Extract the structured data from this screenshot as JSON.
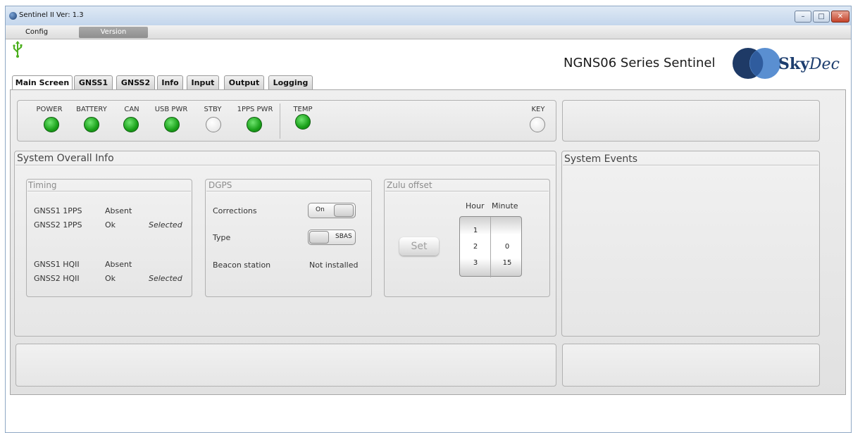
{
  "window": {
    "title": "Sentinel II Ver: 1.3"
  },
  "window_controls": {
    "minimize": "–",
    "maximize": "□",
    "close": "✕"
  },
  "menu": {
    "items": [
      "Config",
      "Version"
    ],
    "active_index": 1
  },
  "header": {
    "series_title": "NGNS06 Series Sentinel",
    "logo_text_a": "Sky",
    "logo_text_b": "Dec"
  },
  "tabs": [
    "Main Screen",
    "GNSS1",
    "GNSS2",
    "Info",
    "Input",
    "Output",
    "Logging"
  ],
  "indicators": [
    {
      "label": "POWER",
      "state": "on"
    },
    {
      "label": "BATTERY",
      "state": "on"
    },
    {
      "label": "CAN",
      "state": "on"
    },
    {
      "label": "USB PWR",
      "state": "on"
    },
    {
      "label": "STBY",
      "state": "off"
    },
    {
      "label": "1PPS PWR",
      "state": "on"
    },
    {
      "label": "TEMP",
      "state": "on"
    },
    {
      "label": "KEY",
      "state": "off"
    }
  ],
  "system_info": {
    "title": "System Overall Info",
    "timing": {
      "title": "Timing",
      "rows": [
        {
          "name": "GNSS1 1PPS",
          "status": "Absent",
          "note": ""
        },
        {
          "name": "GNSS2 1PPS",
          "status": "Ok",
          "note": "Selected"
        },
        {
          "name": "GNSS1 HQII",
          "status": "Absent",
          "note": ""
        },
        {
          "name": "GNSS2 HQII",
          "status": "Ok",
          "note": "Selected"
        }
      ]
    },
    "dgps": {
      "title": "DGPS",
      "corrections_label": "Corrections",
      "corrections_value": "On",
      "type_label": "Type",
      "type_value": "SBAS",
      "beacon_label": "Beacon station",
      "beacon_value": "Not installed"
    },
    "zulu": {
      "title": "Zulu offset",
      "hour_label": "Hour",
      "minute_label": "Minute",
      "set_label": "Set",
      "hours": [
        "1",
        "2",
        "3"
      ],
      "minutes": [
        "",
        "0",
        "15"
      ]
    }
  },
  "system_events": {
    "title": "System Events"
  }
}
